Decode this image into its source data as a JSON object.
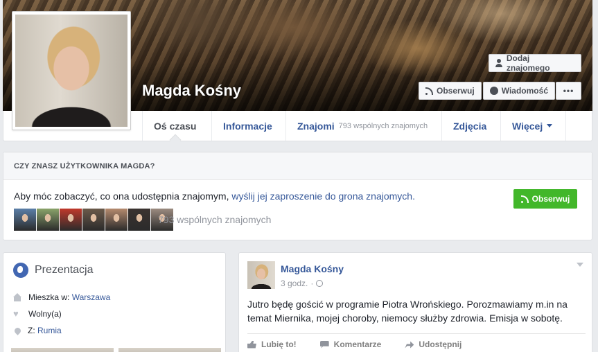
{
  "profile": {
    "name": "Magda Kośny"
  },
  "cover_buttons": {
    "add_friend": "Dodaj znajomego",
    "follow": "Obserwuj",
    "message": "Wiadomość",
    "more": "•••"
  },
  "nav": {
    "tabs": [
      {
        "label": "Oś czasu"
      },
      {
        "label": "Informacje"
      },
      {
        "label": "Znajomi",
        "sub": "793 wspólnych znajomych"
      },
      {
        "label": "Zdjęcia"
      },
      {
        "label": "Więcej"
      }
    ]
  },
  "know_card": {
    "heading": "CZY ZNASZ UŻYTKOWNIKA MAGDA?",
    "text": "Aby móc zobaczyć, co ona udostępnia znajomym,",
    "link": "wyślij jej zaproszenie do grona znajomych.",
    "follow_button": "Obserwuj",
    "mutual_friends": "793 wspólnych znajomych",
    "friend_colors": [
      "#5b7fa8",
      "#8aa36a",
      "#c0392b",
      "#6b5a4a",
      "#b58a6e",
      "#3b3330",
      "#9c8b80"
    ]
  },
  "intro": {
    "title": "Prezentacja",
    "lives_label": "Mieszka w:",
    "lives_value": "Warszawa",
    "relationship": "Wolny(a)",
    "from_label": "Z:",
    "from_value": "Rumia"
  },
  "post": {
    "author": "Magda Kośny",
    "time": "3 godz.",
    "separator": "·",
    "text": "Jutro będę gościć w programie Piotra Wrońskiego. Porozmawiamy m.in na temat Miernika, mojej choroby, niemocy służby zdrowia. Emisja w sobotę.",
    "actions": {
      "like": "Lubię to!",
      "comment": "Komentarze",
      "share": "Udostępnij"
    }
  },
  "colors": {
    "link_blue": "#365899",
    "follow_green": "#42b72a",
    "page_bg": "#e9ebee"
  }
}
